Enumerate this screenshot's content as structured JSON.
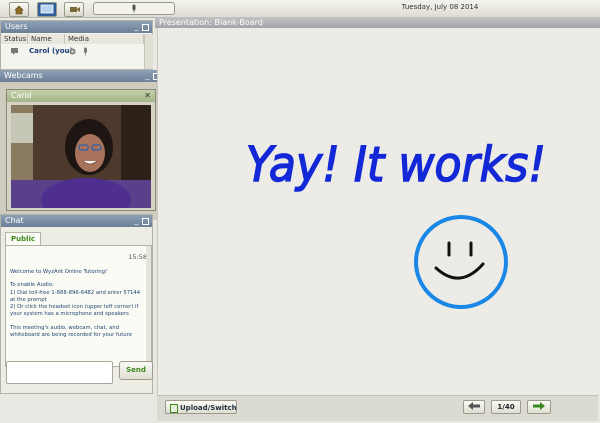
{
  "toolbar": {
    "date": "Tuesday, July 08 2014"
  },
  "users": {
    "title": "Users",
    "columns": [
      "Status",
      "Name",
      "Media"
    ],
    "rows": [
      {
        "name": "Carol (you)"
      }
    ]
  },
  "webcams": {
    "title": "Webcams",
    "window_title": "Carol"
  },
  "chat": {
    "title": "Chat",
    "tab": "Public",
    "time": "15:58",
    "messages": [
      "Welcome to WyzAnt Online Tutoring!",
      "To enable Audio:",
      "1) Dial toll-free 1-888-896-6482 and enter 57144 at the prompt",
      "2) Or click the headset icon (upper left corner) if your system has a microphone and speakers",
      "This meeting's audio, webcam, chat, and whiteboard are being recorded for your future"
    ],
    "send_label": "Send"
  },
  "presentation": {
    "title": "Presentation: Blank-Board",
    "board_text": "Yay! It works!",
    "upload_label": "Upload/Switch",
    "page": "1/40"
  },
  "colors": {
    "ink_blue": "#1328d6",
    "circle_blue": "#1a86e6",
    "header_blue": "#7285a0",
    "accent_green": "#3b8a1e"
  }
}
